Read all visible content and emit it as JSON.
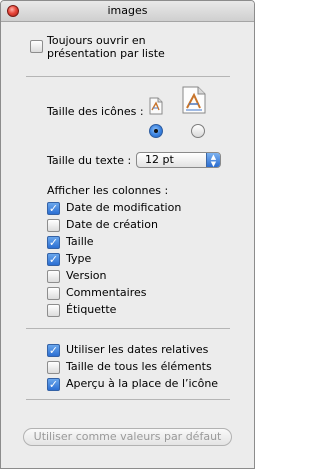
{
  "window": {
    "title": "images"
  },
  "top_option": {
    "label_line1": "Toujours ouvrir en",
    "label_line2": "présentation par liste",
    "checked": false
  },
  "icon_size": {
    "label": "Taille des icônes :",
    "selected": "small"
  },
  "text_size": {
    "label": "Taille du texte :",
    "value": "12 pt"
  },
  "columns": {
    "header": "Afficher les colonnes :",
    "items": [
      {
        "label": "Date de modification",
        "checked": true
      },
      {
        "label": "Date de création",
        "checked": false
      },
      {
        "label": "Taille",
        "checked": true
      },
      {
        "label": "Type",
        "checked": true
      },
      {
        "label": "Version",
        "checked": false
      },
      {
        "label": "Commentaires",
        "checked": false
      },
      {
        "label": "Étiquette",
        "checked": false
      }
    ]
  },
  "options": {
    "items": [
      {
        "label": "Utiliser les dates relatives",
        "checked": true
      },
      {
        "label": "Taille de tous les éléments",
        "checked": false
      },
      {
        "label": "Aperçu à la place de l’icône",
        "checked": true
      }
    ]
  },
  "default_button": {
    "label": "Utiliser comme valeurs par défaut",
    "enabled": false
  },
  "icons": {
    "close": "close-icon",
    "small_document": "document-icon",
    "large_document": "document-icon",
    "popup_arrows": "updown-arrows-icon"
  },
  "colors": {
    "accent": "#2c6fd3",
    "close_red": "#e8473b",
    "window_bg": "#ececec"
  }
}
